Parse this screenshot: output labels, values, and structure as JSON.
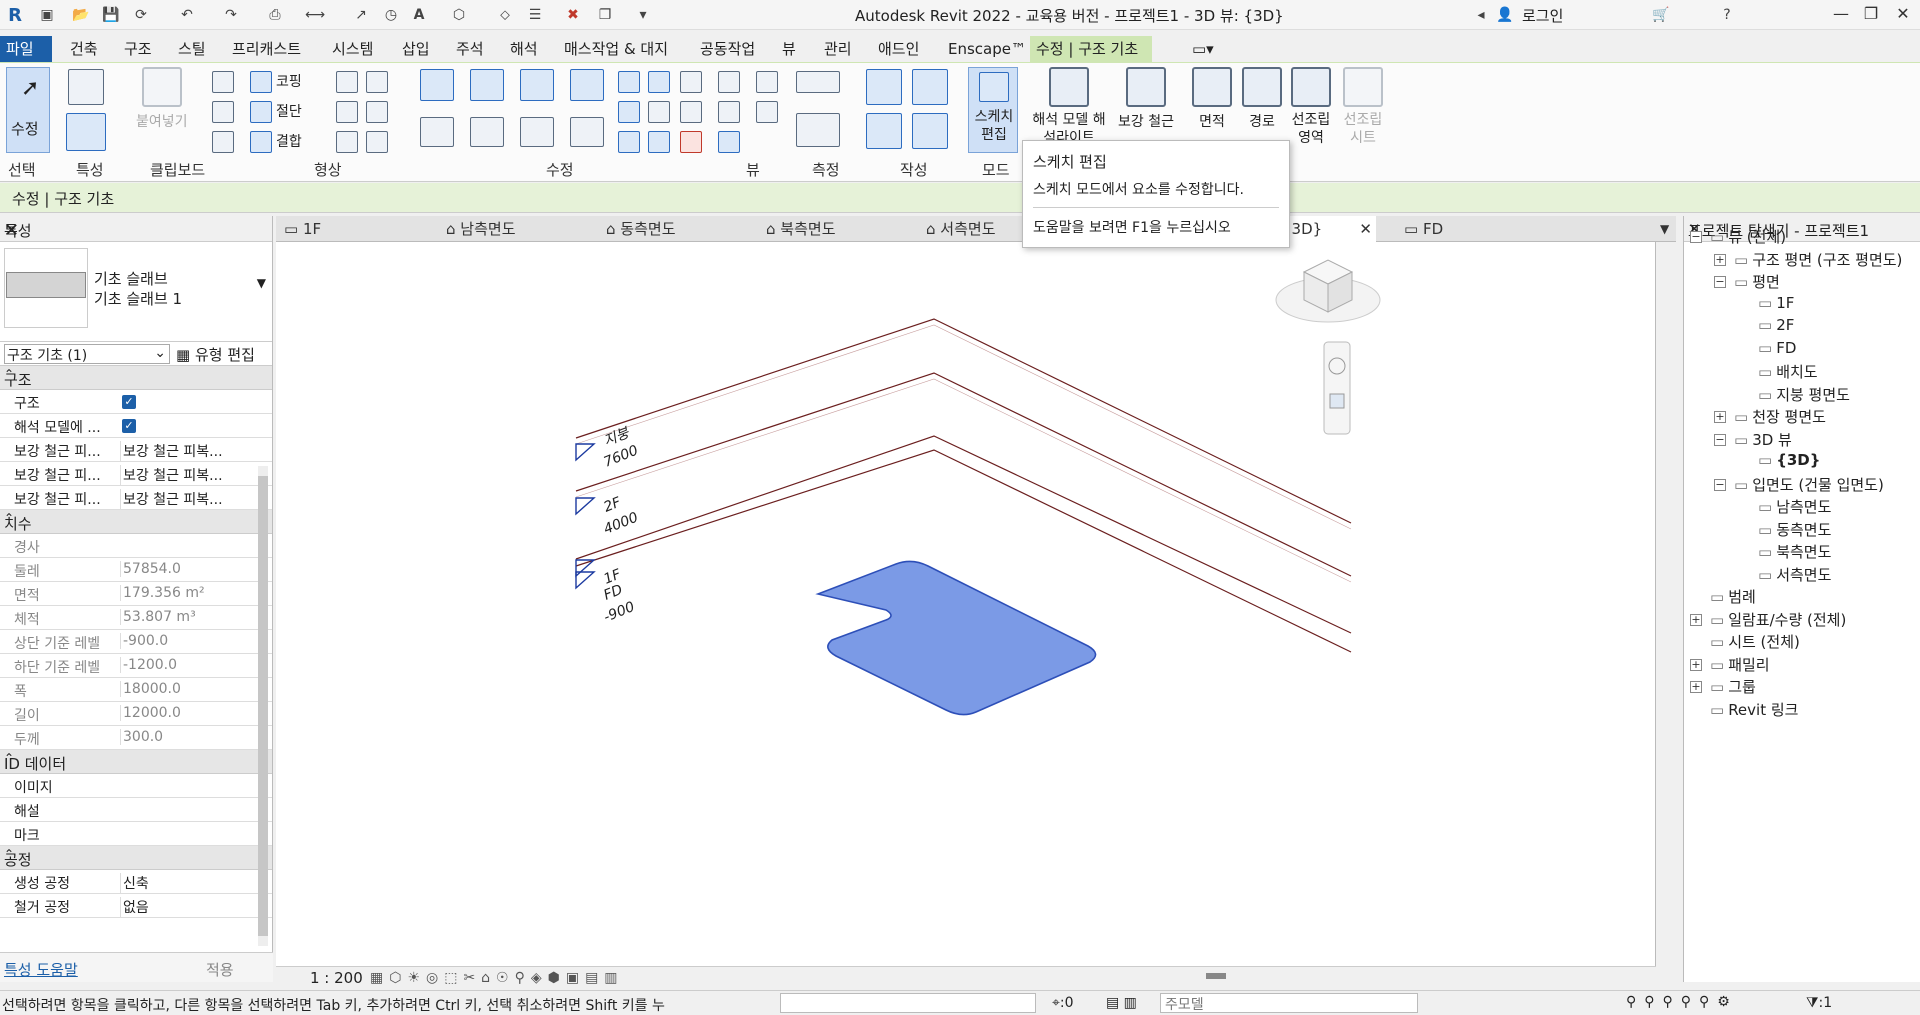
{
  "app": {
    "title": "Autodesk Revit 2022 - 교육용 버전 - 프로젝트1 - 3D 뷰: {3D}",
    "login": "로그인"
  },
  "tabs": [
    "파일",
    "건축",
    "구조",
    "스틸",
    "프리캐스트",
    "시스템",
    "삽입",
    "주석",
    "해석",
    "매스작업 & 대지",
    "공동작업",
    "뷰",
    "관리",
    "애드인",
    "Enscape™",
    "수정 | 구조 기초"
  ],
  "ribbon": {
    "modify_label": "수정",
    "paste_label": "붙여넣기",
    "cope_label": "코핑",
    "cut_label": "절단",
    "join_label": "결합",
    "sketch_edit_label": "스케치 편집",
    "analytical_label": "해석 모델 해석라이트",
    "rebar_label": "보강 철근",
    "area_label": "면적",
    "path_label": "경로",
    "assembly_area_label": "선조립 영역",
    "assembly_sheet_label": "선조립 시트",
    "panels": [
      "선택",
      "특성",
      "클립보드",
      "형상",
      "수정",
      "뷰",
      "측정",
      "작성",
      "모드"
    ]
  },
  "context_bar": "수정 | 구조 기초",
  "properties": {
    "title": "특성",
    "type_name_1": "기초 슬래브",
    "type_name_2": "기초 슬래브 1",
    "instance_selector": "구조 기초 (1)",
    "edit_type": "유형 편집",
    "groups": [
      {
        "name": "구조",
        "rows": [
          {
            "k": "구조",
            "v": "",
            "check": true
          },
          {
            "k": "해석 모델에 ...",
            "v": "",
            "check": true
          },
          {
            "k": "보강 철근 피...",
            "v": "보강 철근 피복..."
          },
          {
            "k": "보강 철근 피...",
            "v": "보강 철근 피복..."
          },
          {
            "k": "보강 철근 피...",
            "v": "보강 철근 피복..."
          }
        ]
      },
      {
        "name": "치수",
        "rows": [
          {
            "k": "경사",
            "v": "",
            "dis": true
          },
          {
            "k": "둘레",
            "v": "57854.0",
            "dis": true
          },
          {
            "k": "면적",
            "v": "179.356 m²",
            "dis": true
          },
          {
            "k": "체적",
            "v": "53.807 m³",
            "dis": true
          },
          {
            "k": "상단 기준 레벨",
            "v": "-900.0",
            "dis": true
          },
          {
            "k": "하단 기준 레벨",
            "v": "-1200.0",
            "dis": true
          },
          {
            "k": "폭",
            "v": "18000.0",
            "dis": true
          },
          {
            "k": "길이",
            "v": "12000.0",
            "dis": true
          },
          {
            "k": "두께",
            "v": "300.0",
            "dis": true
          }
        ]
      },
      {
        "name": "ID 데이터",
        "rows": [
          {
            "k": "이미지",
            "v": ""
          },
          {
            "k": "해설",
            "v": ""
          },
          {
            "k": "마크",
            "v": ""
          }
        ]
      },
      {
        "name": "공정",
        "rows": [
          {
            "k": "생성 공정",
            "v": "신축"
          },
          {
            "k": "철거 공정",
            "v": "없음"
          }
        ]
      }
    ],
    "help_link": "특성 도움말",
    "apply": "적용"
  },
  "view_tabs": [
    "1F",
    "남측면도",
    "동측면도",
    "북측면도",
    "서측면도",
    "{3D}",
    "FD"
  ],
  "levels": [
    {
      "name": "지붕",
      "elev": "7600"
    },
    {
      "name": "2F",
      "elev": "4000"
    },
    {
      "name": "1F",
      "elev": ""
    },
    {
      "name": "FD",
      "elev": "-900"
    }
  ],
  "scale": "1 : 200",
  "tooltip": {
    "title": "스케치 편집",
    "desc": "스케치 모드에서 요소를 수정합니다.",
    "help": "도움말을 보려면 F1을 누르십시오"
  },
  "browser": {
    "title": "프로젝트 탐색기 - 프로젝트1",
    "nodes": [
      {
        "label": "뷰 (전체)",
        "depth": 0,
        "box": "−"
      },
      {
        "label": "구조 평면 (구조 평면도)",
        "depth": 1,
        "box": "+"
      },
      {
        "label": "평면",
        "depth": 1,
        "box": "−"
      },
      {
        "label": "1F",
        "depth": 2
      },
      {
        "label": "2F",
        "depth": 2
      },
      {
        "label": "FD",
        "depth": 2
      },
      {
        "label": "배치도",
        "depth": 2
      },
      {
        "label": "지붕 평면도",
        "depth": 2
      },
      {
        "label": "천장 평면도",
        "depth": 1,
        "box": "+"
      },
      {
        "label": "3D 뷰",
        "depth": 1,
        "box": "−"
      },
      {
        "label": "{3D}",
        "depth": 2,
        "bold": true
      },
      {
        "label": "입면도 (건물 입면도)",
        "depth": 1,
        "box": "−"
      },
      {
        "label": "남측면도",
        "depth": 2
      },
      {
        "label": "동측면도",
        "depth": 2
      },
      {
        "label": "북측면도",
        "depth": 2
      },
      {
        "label": "서측면도",
        "depth": 2
      },
      {
        "label": "범례",
        "depth": 0
      },
      {
        "label": "일람표/수량 (전체)",
        "depth": 0,
        "box": "+"
      },
      {
        "label": "시트 (전체)",
        "depth": 0
      },
      {
        "label": "패밀리",
        "depth": 0,
        "box": "+"
      },
      {
        "label": "그룹",
        "depth": 0,
        "box": "+"
      },
      {
        "label": "Revit 링크",
        "depth": 0
      }
    ]
  },
  "status": {
    "message": "선택하려면 항목을 클릭하고, 다른 항목을 선택하려면 Tab 키, 추가하려면 Ctrl 키, 선택 취소하려면 Shift 키를 누",
    "filter_count": ":0",
    "model": "주모델",
    "select_count": ":1"
  },
  "colors": {
    "accent": "#1c5fa8",
    "context_tab": "#cfe6b3",
    "slab": "#7b9ae6",
    "level_line": "#6b1f1f"
  }
}
